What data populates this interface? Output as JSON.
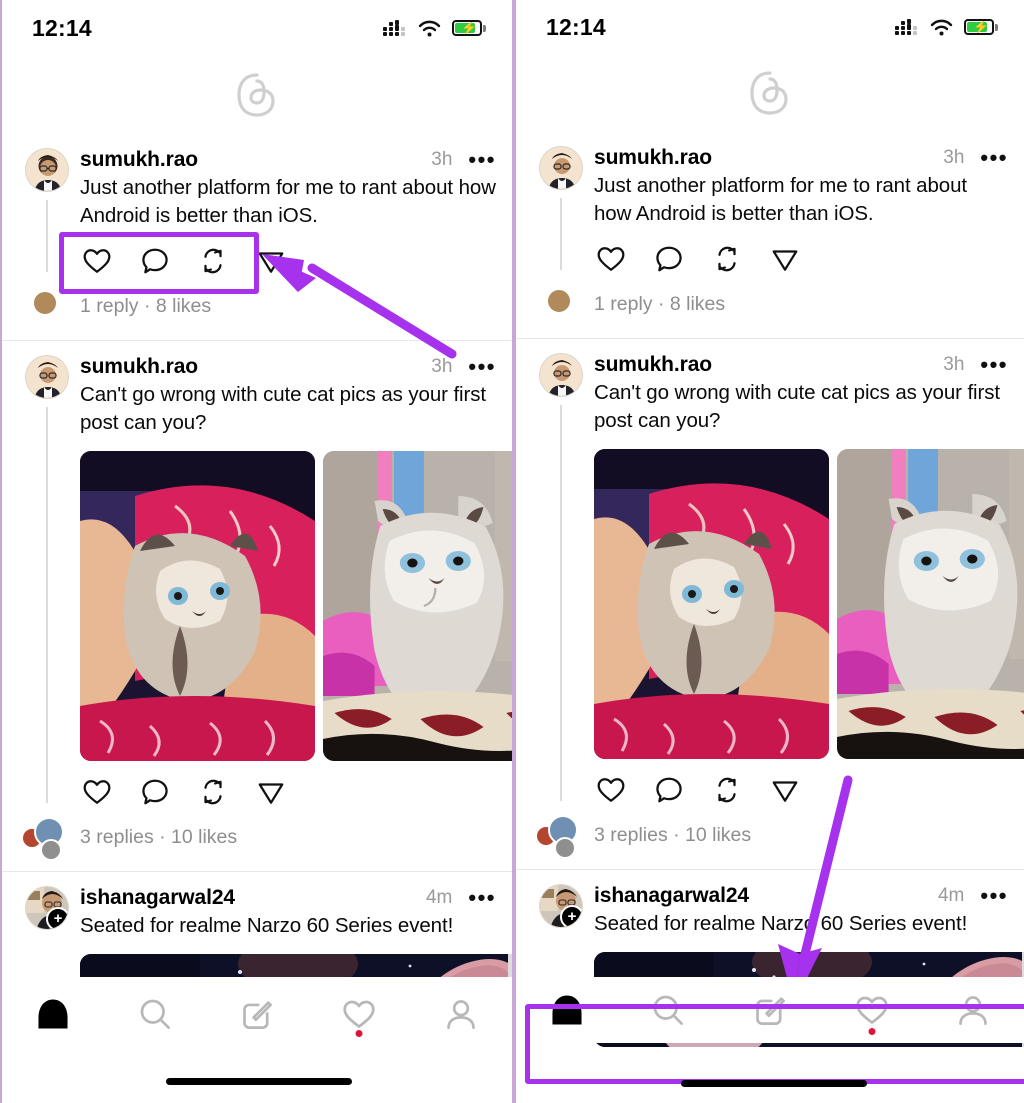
{
  "colors": {
    "highlight_purple": "#a732ee",
    "panel_border": "#c9a6d8",
    "battery_green": "#2ecc41",
    "notification_dot": "#e0123c",
    "muted_text": "#8e8e8e"
  },
  "panels": [
    {
      "id": "left-panel",
      "status_bar": {
        "time": "12:14",
        "icons": [
          "signal-icon",
          "wifi-icon",
          "battery-charging-icon"
        ]
      },
      "app_header": {
        "logo": "threads-logo"
      },
      "posts": [
        {
          "username": "sumukh.rao",
          "time": "3h",
          "more": "•••",
          "text": "Just another platform for me to rant about how Android is better than iOS.",
          "actions": [
            "heart-icon",
            "comment-icon",
            "repost-icon",
            "share-icon"
          ],
          "meta": "1 reply · 8 likes",
          "media": []
        },
        {
          "username": "sumukh.rao",
          "time": "3h",
          "more": "•••",
          "text": "Can't go wrong with cute cat pics as your first post can you?",
          "actions": [
            "heart-icon",
            "comment-icon",
            "repost-icon",
            "share-icon"
          ],
          "meta": "3 replies · 10 likes",
          "media": [
            "kitten-in-hands-photo",
            "kitten-on-carpet-photo"
          ]
        },
        {
          "username": "ishanagarwal24",
          "time": "4m",
          "more": "•••",
          "text": "Seated for realme Narzo 60 Series event!",
          "actions": [],
          "meta": "",
          "media": [
            "event-stage-photo"
          ]
        }
      ],
      "bottom_nav": [
        {
          "icon": "home-icon",
          "active": true,
          "badge": false
        },
        {
          "icon": "search-icon",
          "active": false,
          "badge": false
        },
        {
          "icon": "compose-icon",
          "active": false,
          "badge": false
        },
        {
          "icon": "heart-icon",
          "active": false,
          "badge": true
        },
        {
          "icon": "profile-icon",
          "active": false,
          "badge": false
        }
      ],
      "annotations": {
        "highlight": "post-actions-row",
        "arrow": "arrow-pointing-up-left-to-actions"
      }
    },
    {
      "id": "right-panel",
      "status_bar": {
        "time": "12:14",
        "icons": [
          "signal-icon",
          "wifi-icon",
          "battery-charging-icon"
        ]
      },
      "app_header": {
        "logo": "threads-logo"
      },
      "posts": [
        {
          "username": "sumukh.rao",
          "time": "3h",
          "more": "•••",
          "text": "Just another platform for me to rant about how Android is better than iOS.",
          "actions": [
            "heart-icon",
            "comment-icon",
            "repost-icon",
            "share-icon"
          ],
          "meta": "1 reply · 8 likes",
          "media": []
        },
        {
          "username": "sumukh.rao",
          "time": "3h",
          "more": "•••",
          "text": "Can't go wrong with cute cat pics as your first post can you?",
          "actions": [
            "heart-icon",
            "comment-icon",
            "repost-icon",
            "share-icon"
          ],
          "meta": "3 replies · 10 likes",
          "media": [
            "kitten-in-hands-photo",
            "kitten-on-carpet-photo"
          ]
        },
        {
          "username": "ishanagarwal24",
          "time": "4m",
          "more": "•••",
          "text": "Seated for realme Narzo 60 Series event!",
          "actions": [],
          "meta": "",
          "media": [
            "event-stage-photo"
          ]
        }
      ],
      "bottom_nav": [
        {
          "icon": "home-icon",
          "active": true,
          "badge": false
        },
        {
          "icon": "search-icon",
          "active": false,
          "badge": false
        },
        {
          "icon": "compose-icon",
          "active": false,
          "badge": false
        },
        {
          "icon": "heart-icon",
          "active": false,
          "badge": true
        },
        {
          "icon": "profile-icon",
          "active": false,
          "badge": false
        }
      ],
      "annotations": {
        "highlight": "bottom-navigation-bar",
        "arrow": "arrow-pointing-down-to-nav"
      }
    }
  ]
}
